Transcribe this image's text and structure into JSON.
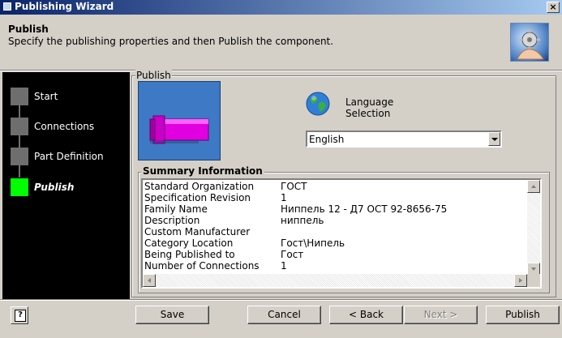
{
  "window": {
    "title": "Publishing Wizard"
  },
  "header": {
    "title": "Publish",
    "subtitle": "Specify the publishing properties and then Publish the component."
  },
  "steps": [
    {
      "label": "Start",
      "active": false
    },
    {
      "label": "Connections",
      "active": false
    },
    {
      "label": "Part Definition",
      "active": false
    },
    {
      "label": "Publish",
      "active": true
    }
  ],
  "publish_group": {
    "legend": "Publish"
  },
  "language": {
    "label_line1": "Language",
    "label_line2": "Selection",
    "selected": "English"
  },
  "summary": {
    "legend": "Summary Information",
    "rows": [
      {
        "key": "Standard Organization",
        "value": "ГОСТ"
      },
      {
        "key": "Specification Revision",
        "value": "1"
      },
      {
        "key": "Family Name",
        "value": "Ниппель 12 - Д7 ОСТ 92-8656-75"
      },
      {
        "key": "Description",
        "value": "ниппель"
      },
      {
        "key": "Custom Manufacturer",
        "value": ""
      },
      {
        "key": "Category Location",
        "value": "Гост\\Нипель"
      },
      {
        "key": "Being Published to",
        "value": "Гост"
      },
      {
        "key": "Number of Connections",
        "value": "1"
      }
    ]
  },
  "buttons": {
    "help": "?",
    "save": "Save",
    "cancel": "Cancel",
    "back": "< Back",
    "next": "Next >",
    "publish": "Publish"
  },
  "colors": {
    "title_bar_start": "#0a246a",
    "step_active": "#00ff00",
    "step_inactive": "#6e6e6e",
    "preview_bg": "#3d79c4",
    "part_color": "#e000e0"
  }
}
